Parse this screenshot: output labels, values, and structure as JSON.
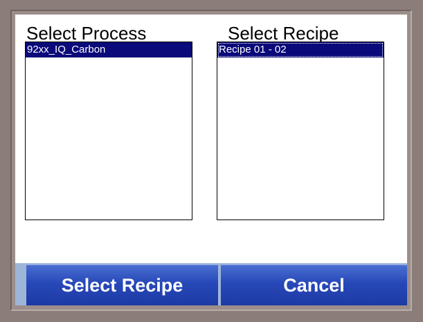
{
  "process_column": {
    "title": "Select Process",
    "items": [
      "92xx_IQ_Carbon"
    ]
  },
  "recipe_column": {
    "title": "Select Recipe",
    "items": [
      "Recipe 01 - 02"
    ]
  },
  "buttons": {
    "select_recipe": "Select Recipe",
    "cancel": "Cancel"
  },
  "colors": {
    "bezel": "#8b7d7a",
    "selection": "#0a0a7a",
    "button": "#2748b8"
  }
}
